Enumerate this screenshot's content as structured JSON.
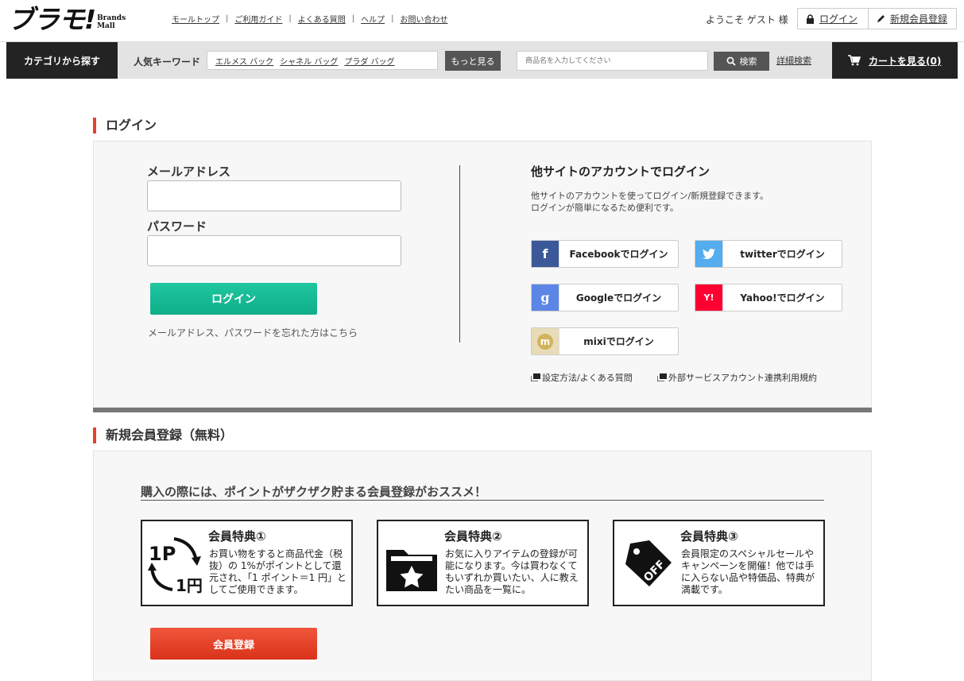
{
  "header": {
    "logo_main": "ブラモ!",
    "logo_sub_line1": "Brands",
    "logo_sub_line2": "Mall",
    "links": [
      "モールトップ",
      "ご利用ガイド",
      "よくある質問",
      "ヘルプ",
      "お問い合わせ"
    ],
    "welcome": "ようこそ ゲスト 様",
    "login_label": "ログイン",
    "register_label": "新規会員登録"
  },
  "nav": {
    "category_label": "カテゴリから探す",
    "keyword_label": "人気キーワード",
    "keywords": [
      "エルメス バック",
      "シャネル バッグ",
      "プラダ バッグ"
    ],
    "more_label": "もっと見る",
    "search_placeholder": "商品名を入力してください",
    "search_button": "検索",
    "advanced_search": "詳細検索",
    "cart_label": "カートを見る(0)"
  },
  "login": {
    "section_title": "ログイン",
    "email_label": "メールアドレス",
    "password_label": "パスワード",
    "login_button": "ログイン",
    "forgot_link": "メールアドレス、パスワードを忘れた方はこちら",
    "social_title": "他サイトのアカウントでログイン",
    "social_desc_line1": "他サイトのアカウントを使ってログイン/新規登録できます。",
    "social_desc_line2": "ログインが簡単になるため便利です。",
    "social_buttons": [
      {
        "label": "Facebookでログイン",
        "icon": "facebook-icon",
        "glyph": "f",
        "color": "#3b5998"
      },
      {
        "label": "twitterでログイン",
        "icon": "twitter-icon",
        "glyph": "",
        "color": "#55acee"
      },
      {
        "label": "Googleでログイン",
        "icon": "google-icon",
        "glyph": "g",
        "color": "#5b86e5"
      },
      {
        "label": "Yahoo!でログイン",
        "icon": "yahoo-icon",
        "glyph": "Y!",
        "color": "#ff0033"
      },
      {
        "label": "mixiでログイン",
        "icon": "mixi-icon",
        "glyph": "m",
        "color": "#d1b35a"
      }
    ],
    "help_link": "設定方法/よくある質問",
    "terms_link": "外部サービスアカウント連携利用規約"
  },
  "register": {
    "section_title": "新規会員登録（無料）",
    "promo": "購入の際には、ポイントがザクザク貯まる会員登録がおススメ！",
    "benefits": [
      {
        "title": "会員特典①",
        "icon": "points-cycle-icon",
        "icon_text_top": "1P",
        "icon_text_bottom": "1円",
        "desc": "お買い物をすると商品代金（税抜）の 1%がポイントとして還元され、「1 ポイント＝1 円」としてご使用できます。"
      },
      {
        "title": "会員特典②",
        "icon": "folder-star-icon",
        "desc": "お気に入りアイテムの登録が可能になります。今は買わなくてもいずれか買いたい、人に教えたい商品を一覧に。"
      },
      {
        "title": "会員特典③",
        "icon": "off-tag-icon",
        "icon_text": "OFF",
        "desc": "会員限定のスペシャルセールやキャンペーンを開催！他では手に入らない品や特価品、特典が満載です。"
      }
    ],
    "register_button": "会員登録"
  }
}
